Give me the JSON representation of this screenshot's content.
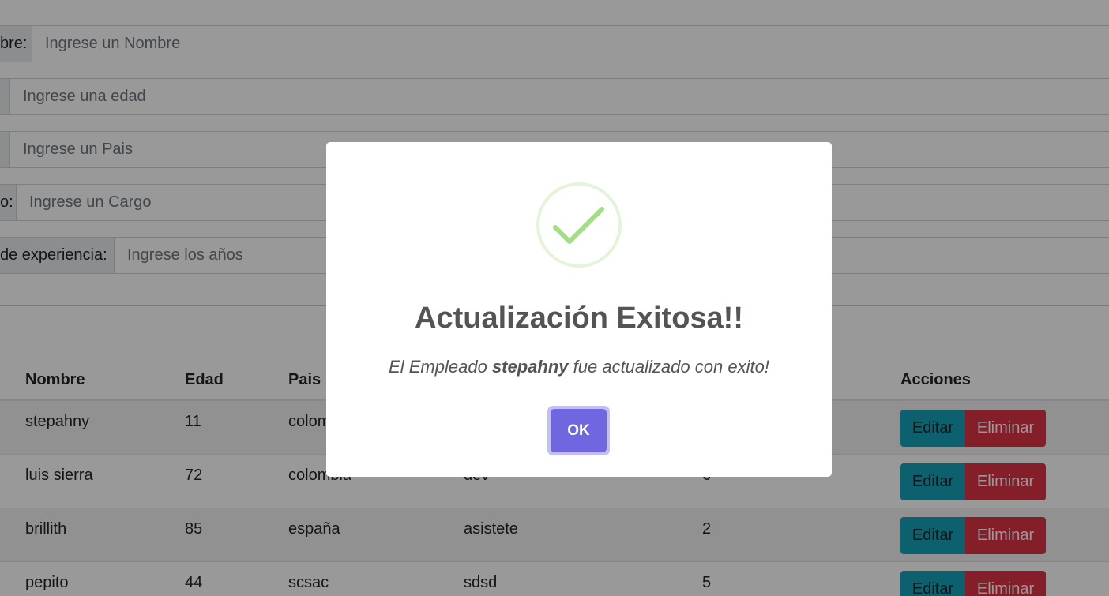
{
  "form": {
    "nombre": {
      "label": "bre:",
      "placeholder": "Ingrese un Nombre"
    },
    "edad": {
      "label": "",
      "placeholder": "Ingrese una edad"
    },
    "pais": {
      "label": "",
      "placeholder": "Ingrese un Pais"
    },
    "cargo": {
      "label": "o:",
      "placeholder": "Ingrese un Cargo"
    },
    "anios": {
      "label": "de experiencia:",
      "placeholder": "Ingrese los años"
    }
  },
  "table": {
    "headers": {
      "nombre": "Nombre",
      "edad": "Edad",
      "pais": "Pais",
      "cargo": "",
      "anios": "",
      "acciones": "Acciones"
    },
    "rows": [
      {
        "nombre": "stepahny",
        "edad": "11",
        "pais": "colom",
        "cargo": "",
        "anios": ""
      },
      {
        "nombre": "luis sierra",
        "edad": "72",
        "pais": "colombia",
        "cargo": "dev",
        "anios": "6"
      },
      {
        "nombre": "brillith",
        "edad": "85",
        "pais": "españa",
        "cargo": "asistete",
        "anios": "2"
      },
      {
        "nombre": "pepito",
        "edad": "44",
        "pais": "scsac",
        "cargo": "sdsd",
        "anios": "5"
      }
    ],
    "edit_label": "Editar",
    "delete_label": "Eliminar"
  },
  "modal": {
    "icon": "success-check-icon",
    "title": "Actualización Exitosa!!",
    "text_prefix": "El Empleado ",
    "text_name": "stepahny",
    "text_suffix": " fue actualizado con exito!",
    "ok_label": "OK"
  },
  "colors": {
    "overlay": "rgba(0,0,0,0.4)",
    "ok_button": "#7066e0",
    "success_icon": "#a5dc86",
    "edit_button": "#17a2b8",
    "delete_button": "#dc3545"
  }
}
